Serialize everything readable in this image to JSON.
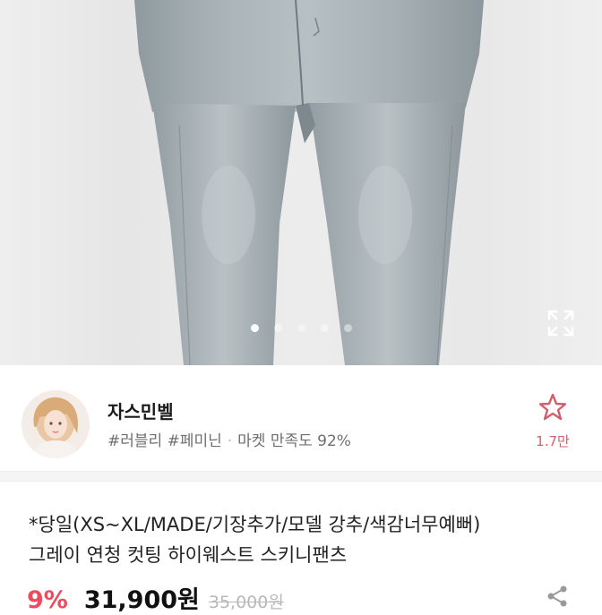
{
  "gallery": {
    "image_description_icon": "jeans-photo",
    "dot_count": 5,
    "active_dot_index": 0,
    "expand_icon": "expand-icon"
  },
  "seller": {
    "name": "자스민벨",
    "tags": "#러블리 #페미닌",
    "satisfaction_label": "마켓 만족도 92%",
    "like_icon": "star-outline-icon",
    "like_count": "1.7만",
    "accent_color": "#d0606e"
  },
  "product": {
    "title_line1": "*당일(XS~XL/MADE/기장추가/모델 강추/색감너무예뻐)",
    "title_line2": "그레이 연청 컷팅 하이웨스트 스키니팬츠",
    "discount": "9%",
    "price": "31,900원",
    "original_price": "35,000원",
    "discount_color": "#ec4c5d"
  }
}
